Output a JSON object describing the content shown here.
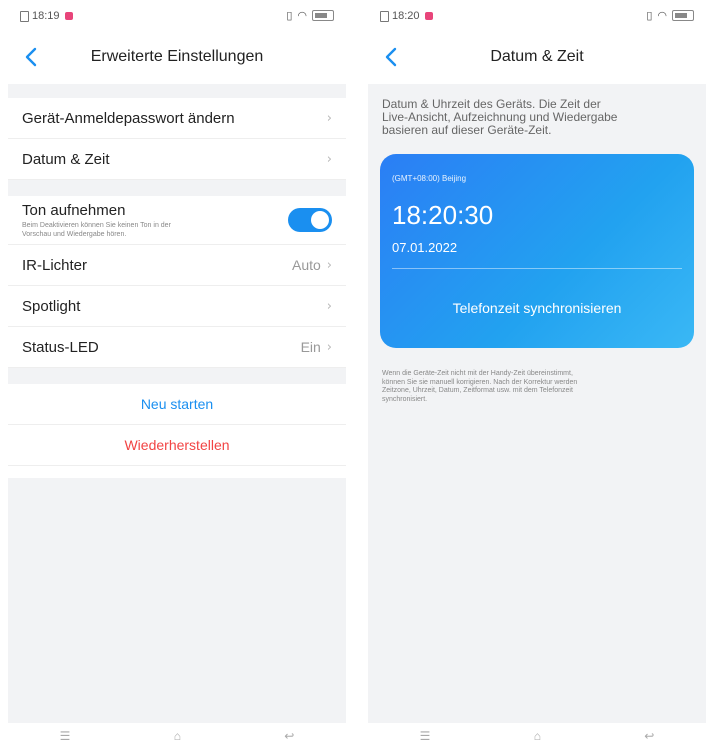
{
  "left": {
    "status": {
      "time": "18:19"
    },
    "title": "Erweiterte Einstellungen",
    "group1": [
      {
        "label": "Gerät-Anmeldepasswort ändern",
        "value": ""
      },
      {
        "label": "Datum & Zeit",
        "value": ""
      }
    ],
    "sound": {
      "label": "Ton aufnehmen",
      "desc_line1": "Beim Deaktivieren können Sie keinen Ton in der",
      "desc_line2": "Vorschau und Wiedergabe hören.",
      "enabled": true
    },
    "group2": [
      {
        "label": "IR-Lichter",
        "value": "Auto"
      },
      {
        "label": "Spotlight",
        "value": ""
      },
      {
        "label": "Status-LED",
        "value": "Ein"
      }
    ],
    "restart_label": "Neu starten",
    "restore_label": "Wiederherstellen"
  },
  "right": {
    "status": {
      "time": "18:20"
    },
    "title": "Datum & Zeit",
    "info_line1": "Datum & Uhrzeit des Geräts. Die Zeit der",
    "info_line2": "Live-Ansicht, Aufzeichnung und Wiedergabe",
    "info_line3": "basieren auf dieser Geräte-Zeit.",
    "card": {
      "timezone": "(GMT+08:00) Beijing",
      "time": "18:20:30",
      "date": "07.01.2022",
      "sync_label": "Telefonzeit synchronisieren"
    },
    "note_line1": "Wenn die Geräte-Zeit nicht mit der Handy-Zeit übereinstimmt,",
    "note_line2": "können Sie sie manuell korrigieren. Nach der Korrektur werden",
    "note_line3": "Zeitzone, Uhrzeit, Datum, Zeitformat usw. mit dem Telefonzeit",
    "note_line4": "synchronisiert."
  },
  "colors": {
    "accent": "#1a8ff0",
    "danger": "#f24444",
    "card_start": "#2b7ef5",
    "card_end": "#3ab8f5"
  }
}
